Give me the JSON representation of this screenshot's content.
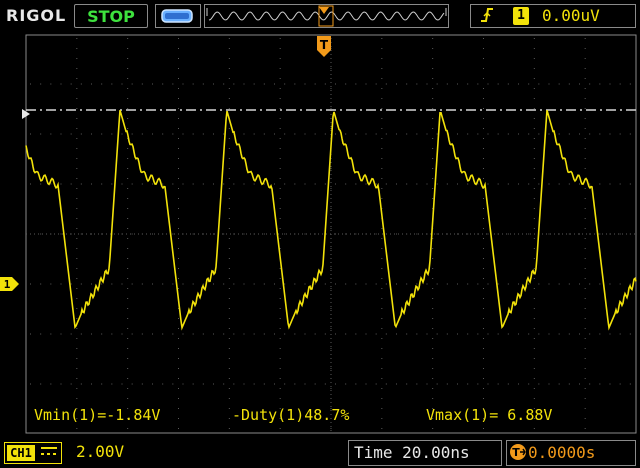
{
  "header": {
    "brand": "RIGOL",
    "run_state": "STOP",
    "trigger": {
      "edge_icon": "rising-edge-icon",
      "channel": "1",
      "level": "0.00uV"
    }
  },
  "display": {
    "trigger_position_marker": "T",
    "channel_marker": "1"
  },
  "measurements": {
    "vmin": "Vmin(1)=-1.84V",
    "duty": "-Duty(1)48.7%",
    "vmax": "Vmax(1)= 6.88V"
  },
  "footer": {
    "channel_badge": "CH1",
    "coupling_icon": "dc-coupling-icon",
    "channel_scale": "2.00V",
    "time_base": "Time 20.00ns",
    "trigger_offset_icon": "trigger-offset-icon",
    "trigger_offset": "0.0000s"
  },
  "colors": {
    "trace": "#f2e20a",
    "run_stop": "#3ee23e",
    "trigger": "#f29a1a",
    "grid": "#5a5a5a"
  },
  "waveform": {
    "period_divisions": 2.1,
    "vmax": 6.88,
    "vmin": -1.84,
    "volts_per_div": 2.0
  }
}
